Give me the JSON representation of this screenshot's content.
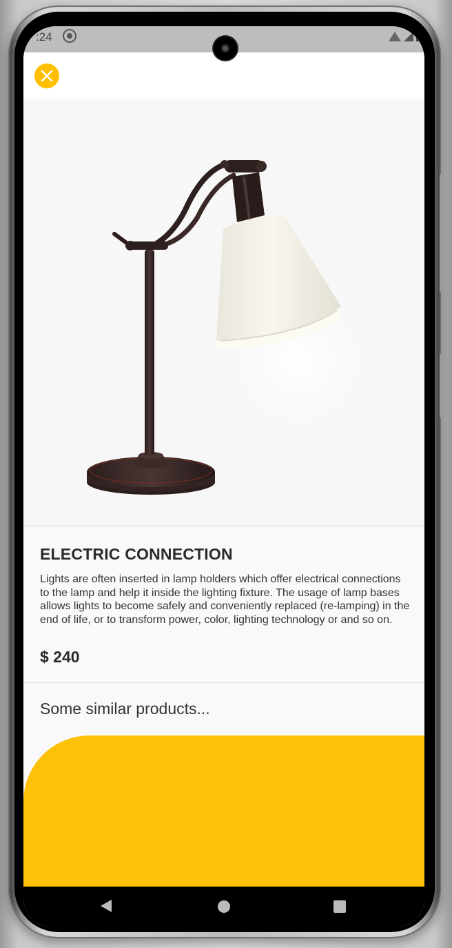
{
  "status_bar": {
    "time": ":24"
  },
  "product": {
    "title": "ELECTRIC CONNECTION",
    "description": "Lights are often inserted in lamp holders which offer electrical connections to the lamp and help it inside the lighting fixture. The usage of lamp bases allows lights to become safely and conveniently replaced (re-lamping) in the end of life, or to transform power, color, lighting technology or and so on.",
    "price": "$ 240"
  },
  "similar_heading": "Some similar products...",
  "icons": {
    "close": "close-icon",
    "back": "back-icon",
    "home": "home-icon",
    "recents": "recents-icon",
    "sync": "sync-icon",
    "wifi": "wifi-icon",
    "signal": "signal-icon",
    "battery": "battery-icon"
  },
  "colors": {
    "accent": "#fdc108",
    "background": "#f9f9f9",
    "text": "#2a2a2a"
  }
}
